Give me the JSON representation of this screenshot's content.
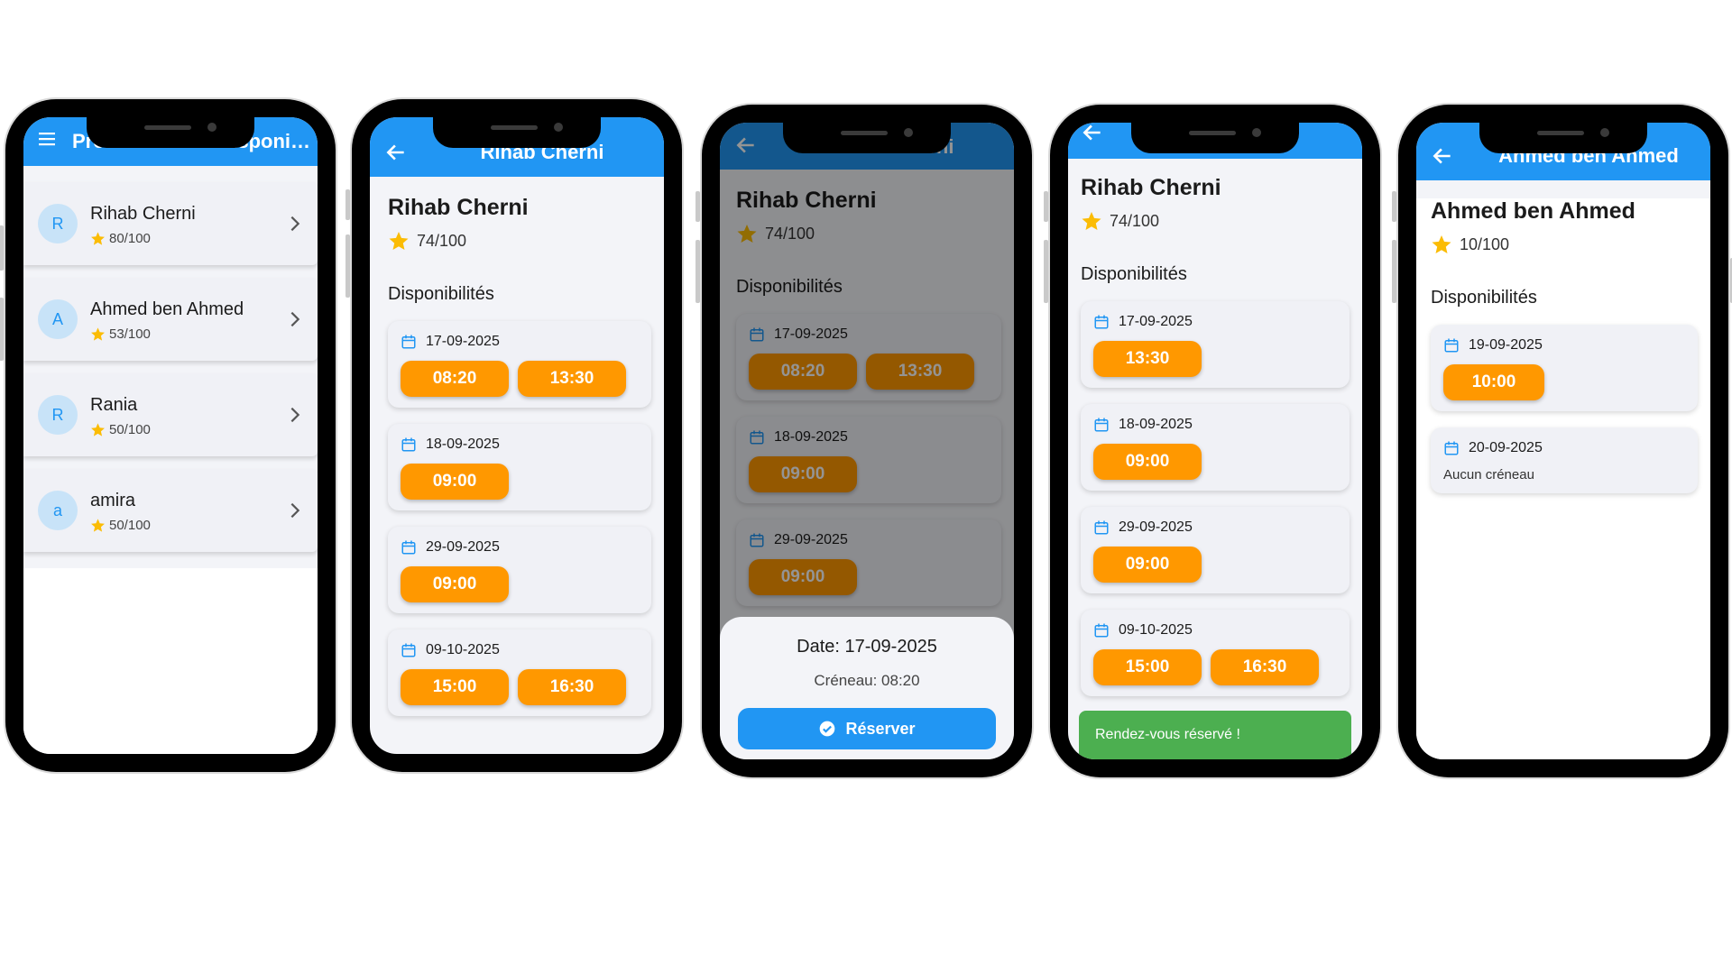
{
  "colors": {
    "primary": "#2196f3",
    "slot": "#ff9800",
    "success": "#4caf50"
  },
  "screen1": {
    "title": "Professionnels disponibl...",
    "professionals": [
      {
        "initial": "R",
        "name": "Rihab Cherni",
        "score": "80/100"
      },
      {
        "initial": "A",
        "name": "Ahmed ben Ahmed",
        "score": "53/100"
      },
      {
        "initial": "R",
        "name": "Rania",
        "score": "50/100"
      },
      {
        "initial": "a",
        "name": "amira",
        "score": "50/100"
      }
    ]
  },
  "screen2": {
    "title": "Rihab Cherni",
    "name": "Rihab Cherni",
    "score": "74/100",
    "section": "Disponibilités",
    "days": [
      {
        "date": "17-09-2025",
        "slots": [
          "08:20",
          "13:30"
        ]
      },
      {
        "date": "18-09-2025",
        "slots": [
          "09:00"
        ]
      },
      {
        "date": "29-09-2025",
        "slots": [
          "09:00"
        ]
      },
      {
        "date": "09-10-2025",
        "slots": [
          "15:00",
          "16:30"
        ]
      }
    ]
  },
  "screen3": {
    "title": "Rihab Cherni",
    "name": "Rihab Cherni",
    "score": "74/100",
    "section": "Disponibilités",
    "days": [
      {
        "date": "17-09-2025",
        "slots": [
          "08:20",
          "13:30"
        ]
      },
      {
        "date": "18-09-2025",
        "slots": [
          "09:00"
        ]
      },
      {
        "date": "29-09-2025",
        "slots": [
          "09:00"
        ]
      }
    ],
    "sheet": {
      "date": "Date: 17-09-2025",
      "slot": "Créneau: 08:20",
      "button": "Réserver"
    }
  },
  "screen4": {
    "name": "Rihab Cherni",
    "score": "74/100",
    "section": "Disponibilités",
    "days": [
      {
        "date": "17-09-2025",
        "slots": [
          "13:30"
        ]
      },
      {
        "date": "18-09-2025",
        "slots": [
          "09:00"
        ]
      },
      {
        "date": "29-09-2025",
        "slots": [
          "09:00"
        ]
      },
      {
        "date": "09-10-2025",
        "slots": [
          "15:00",
          "16:30"
        ]
      }
    ],
    "snackbar": "Rendez-vous réservé !"
  },
  "screen5": {
    "title": "Ahmed ben Ahmed",
    "name": "Ahmed ben Ahmed",
    "score": "10/100",
    "section": "Disponibilités",
    "days": [
      {
        "date": "19-09-2025",
        "slots": [
          "10:00"
        ]
      },
      {
        "date": "20-09-2025",
        "slots": [],
        "empty": "Aucun créneau"
      }
    ]
  }
}
